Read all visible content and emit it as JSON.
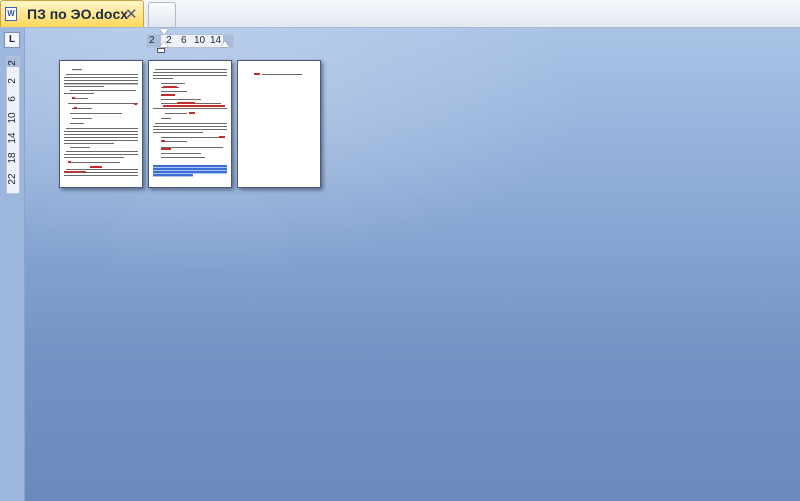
{
  "tabbar": {
    "active_tab_title": "ПЗ по ЭО.docx",
    "close_glyph": "✕",
    "app_icon_letter": "W",
    "app_icon": "word-document-icon",
    "new_tab_icon": "new-tab-icon"
  },
  "ruler": {
    "tab_selector": "L",
    "horizontal_labels": [
      "2",
      "2",
      "6",
      "10",
      "14"
    ],
    "vertical_labels": [
      "2",
      "2",
      "6",
      "10",
      "14",
      "18",
      "22"
    ]
  },
  "document": {
    "page_count": 3
  },
  "colors": {
    "tab_active": "#ffd75a",
    "workspace": "#8eabd7",
    "page": "#ffffff",
    "spelling_error": "#c62b2b",
    "selection": "#3c6fd6"
  }
}
